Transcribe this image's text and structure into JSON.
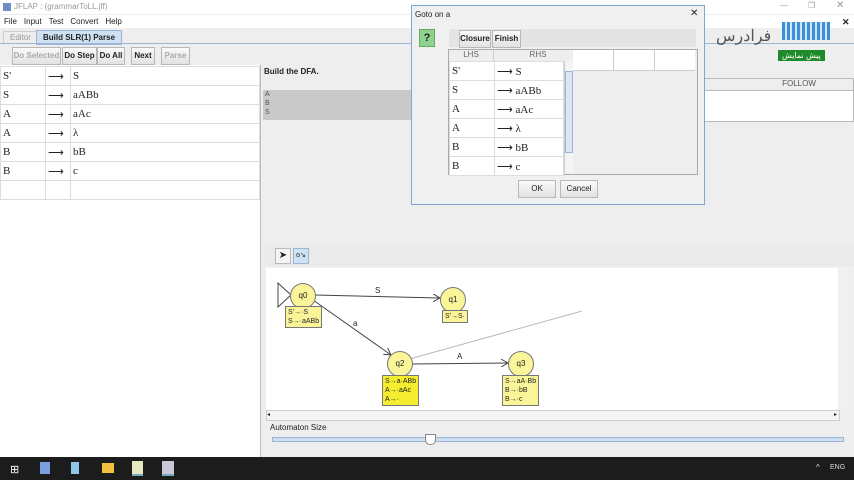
{
  "window": {
    "title": "JFLAP : (grammarToLL.jff)"
  },
  "menu": [
    "File",
    "Input",
    "Test",
    "Convert",
    "Help"
  ],
  "tabs": [
    "Editor",
    "Build SLR(1) Parse"
  ],
  "toolbar": {
    "do_selected": "Do Selected",
    "do_step": "Do Step",
    "do_all": "Do All",
    "next": "Next",
    "parse": "Parse"
  },
  "grammar": [
    {
      "lhs": "S'",
      "rhs": "S"
    },
    {
      "lhs": "S",
      "rhs": "aABb"
    },
    {
      "lhs": "A",
      "rhs": "aAc"
    },
    {
      "lhs": "A",
      "rhs": "λ"
    },
    {
      "lhs": "B",
      "rhs": "bB"
    },
    {
      "lhs": "B",
      "rhs": "c"
    }
  ],
  "arrow": "⟶",
  "right": {
    "instruction": "Build the DFA.",
    "symbols": [
      "A",
      "B",
      "S"
    ],
    "follow_header": "FOLLOW"
  },
  "dialog": {
    "title": "Goto on a",
    "help": "?",
    "closure": "Closure",
    "finish": "Finish",
    "lhs_header": "LHS",
    "rhs_header": "RHS",
    "ok": "OK",
    "cancel": "Cancel"
  },
  "automaton": {
    "states": [
      {
        "name": "q0",
        "items": [
          "S'→·S",
          "S→·aABb"
        ]
      },
      {
        "name": "q1",
        "items": [
          "S'→S·"
        ]
      },
      {
        "name": "q2",
        "items": [
          "S→a·ABb",
          "A→·aAc",
          "A→·"
        ]
      },
      {
        "name": "q3",
        "items": [
          "S→aA·Bb",
          "B→·bB",
          "B→·c"
        ]
      }
    ],
    "transitions": [
      {
        "from": "q0",
        "to": "q1",
        "label": "S"
      },
      {
        "from": "q0",
        "to": "q2",
        "label": "a"
      },
      {
        "from": "q2",
        "to": "q3",
        "label": "A"
      }
    ],
    "size_label": "Automaton Size",
    "size_value": 0.55
  },
  "watermark": {
    "brand": "فرادرس",
    "badge": "پیش نمایش"
  },
  "taskbar": {
    "lang": "ENG"
  }
}
